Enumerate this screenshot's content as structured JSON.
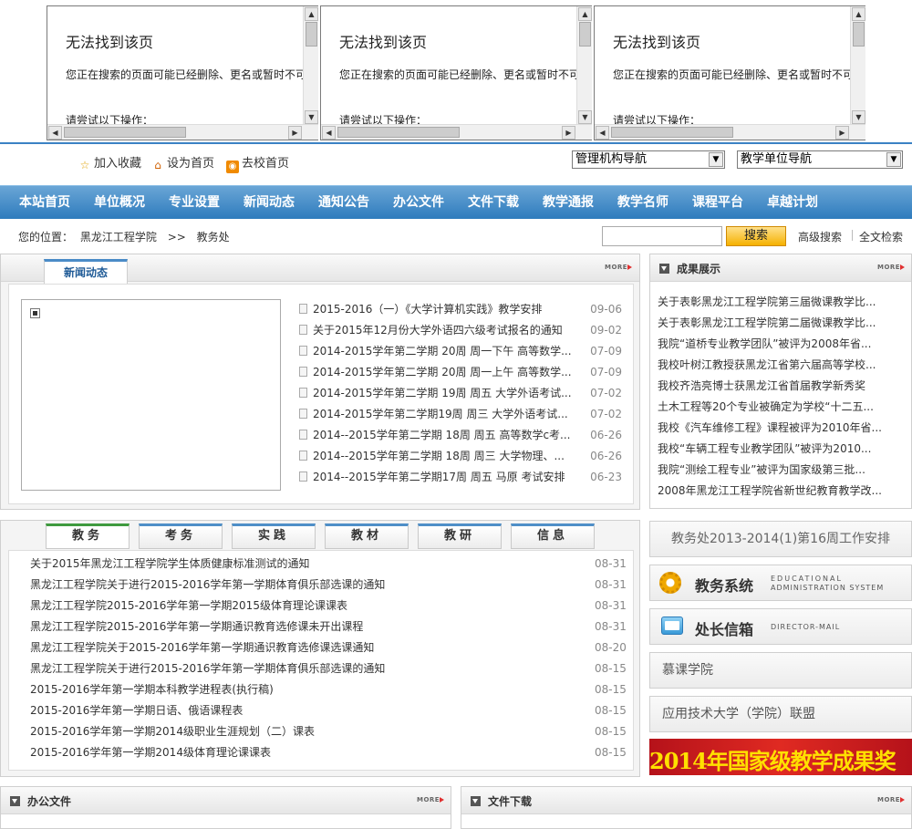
{
  "frames": [
    {
      "title": "无法找到该页",
      "message": "您正在搜索的页面可能已经删除、更名或暂时不可用。",
      "try": "请尝试以下操作："
    },
    {
      "title": "无法找到该页",
      "message": "您正在搜索的页面可能已经删除、更名或暂时不可用。",
      "try": "请尝试以下操作："
    },
    {
      "title": "无法找到该页",
      "message": "您正在搜索的页面可能已经删除、更名或暂时不可用。",
      "try": "请尝试以下操作："
    }
  ],
  "toplinks": {
    "favorite": "加入收藏",
    "homepage": "设为首页",
    "school": "去校首页"
  },
  "selects": {
    "admin_nav": "管理机构导航",
    "teaching_nav": "教学单位导航"
  },
  "nav": [
    "本站首页",
    "单位概况",
    "专业设置",
    "新闻动态",
    "通知公告",
    "办公文件",
    "文件下载",
    "教学通报",
    "教学名师",
    "课程平台",
    "卓越计划"
  ],
  "location": {
    "label": "您的位置：",
    "school": "黑龙江工程学院",
    "sep": ">>",
    "dept": "教务处"
  },
  "search": {
    "button": "搜索",
    "advanced": "高级搜索",
    "fulltext": "全文检索"
  },
  "more_label": "MORE",
  "news": {
    "tab": "新闻动态",
    "items": [
      {
        "title": "2015-2016（一）《大学计算机实践》教学安排",
        "date": "09-06"
      },
      {
        "title": "关于2015年12月份大学外语四六级考试报名的通知",
        "date": "09-02"
      },
      {
        "title": "2014-2015学年第二学期 20周 周一下午 高等数学...",
        "date": "07-09"
      },
      {
        "title": "2014-2015学年第二学期 20周 周一上午 高等数学...",
        "date": "07-09"
      },
      {
        "title": "2014-2015学年第二学期 19周 周五 大学外语考试...",
        "date": "07-02"
      },
      {
        "title": "2014-2015学年第二学期19周 周三 大学外语考试...",
        "date": "07-02"
      },
      {
        "title": "2014--2015学年第二学期 18周 周五 高等数学c考...",
        "date": "06-26"
      },
      {
        "title": "2014--2015学年第二学期 18周 周三 大学物理、...",
        "date": "06-26"
      },
      {
        "title": "2014--2015学年第二学期17周 周五 马原 考试安排",
        "date": "06-23"
      }
    ]
  },
  "achievements": {
    "title": "成果展示",
    "items": [
      "关于表彰黑龙江工程学院第三届微课教学比...",
      "关于表彰黑龙江工程学院第二届微课教学比...",
      "我院“道桥专业教学团队”被评为2008年省...",
      "我校叶树江教授获黑龙江省第六届高等学校...",
      "我校齐浩亮博士获黑龙江省首届教学新秀奖",
      "土木工程等20个专业被确定为学校“十二五...",
      "我校《汽车维修工程》课程被评为2010年省...",
      "我校“车辆工程专业教学团队”被评为2010...",
      "我院“测绘工程专业”被评为国家级第三批...",
      "2008年黑龙江工程学院省新世纪教育教学改..."
    ]
  },
  "tabs2": [
    "教务",
    "考务",
    "实践",
    "教材",
    "教研",
    "信息"
  ],
  "notices": [
    {
      "title": "关于2015年黑龙江工程学院学生体质健康标准测试的通知",
      "date": "08-31"
    },
    {
      "title": "黑龙江工程学院关于进行2015-2016学年第一学期体育俱乐部选课的通知",
      "date": "08-31"
    },
    {
      "title": "黑龙江工程学院2015-2016学年第一学期2015级体育理论课课表",
      "date": "08-31"
    },
    {
      "title": "黑龙江工程学院2015-2016学年第一学期通识教育选修课未开出课程",
      "date": "08-31"
    },
    {
      "title": "黑龙江工程学院关于2015-2016学年第一学期通识教育选修课选课通知",
      "date": "08-20"
    },
    {
      "title": "黑龙江工程学院关于进行2015-2016学年第一学期体育俱乐部选课的通知",
      "date": "08-15"
    },
    {
      "title": "2015-2016学年第一学期本科教学进程表(执行稿)",
      "date": "08-15"
    },
    {
      "title": "2015-2016学年第一学期日语、俄语课程表",
      "date": "08-15"
    },
    {
      "title": "2015-2016学年第一学期2014级职业生涯规划（二）课表",
      "date": "08-15"
    },
    {
      "title": "2015-2016学年第一学期2014级体育理论课课表",
      "date": "08-15"
    }
  ],
  "side_cards": {
    "schedule": "教务处2013-2014(1)第16周工作安排",
    "system_cn": "教务系统",
    "system_en1": "EDUCATIONAL",
    "system_en2": "ADMINISTRATION SYSTEM",
    "mail_cn": "处长信箱",
    "mail_en": "DIRECTOR-MAIL",
    "mooc": "慕课学院",
    "alliance": "应用技术大学（学院）联盟",
    "banner": "2014年国家级教学成果奖"
  },
  "bottom": {
    "office": "办公文件",
    "download": "文件下载"
  },
  "colors": {
    "nav": "#2e7bbd",
    "accent": "#4a8bc7",
    "banner_red": "#c8161d",
    "banner_text": "#ffe000"
  }
}
